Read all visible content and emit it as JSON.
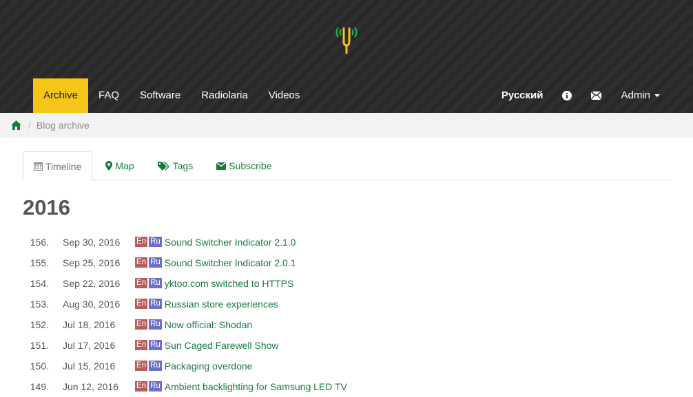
{
  "header": {
    "nav": [
      {
        "label": "Archive",
        "active": true
      },
      {
        "label": "FAQ"
      },
      {
        "label": "Software"
      },
      {
        "label": "Radiolaria"
      },
      {
        "label": "Videos"
      }
    ],
    "language": "Русский",
    "info_icon": "info-icon",
    "mail_icon": "envelope-icon",
    "user_menu": "Admin"
  },
  "breadcrumb": {
    "home_icon": "home-icon",
    "current": "Blog archive"
  },
  "tabs": [
    {
      "label": "Timeline",
      "icon": "calendar-icon",
      "active": true
    },
    {
      "label": "Map",
      "icon": "map-marker-icon"
    },
    {
      "label": "Tags",
      "icon": "tags-icon"
    },
    {
      "label": "Subscribe",
      "icon": "envelope-icon"
    }
  ],
  "year": "2016",
  "posts": [
    {
      "num": "156.",
      "date": "Sep 30, 2016",
      "flags": [
        "En",
        "Ru"
      ],
      "title": "Sound Switcher Indicator 2.1.0"
    },
    {
      "num": "155.",
      "date": "Sep 25, 2016",
      "flags": [
        "En",
        "Ru"
      ],
      "title": "Sound Switcher Indicator 2.0.1"
    },
    {
      "num": "154.",
      "date": "Sep 22, 2016",
      "flags": [
        "En",
        "Ru"
      ],
      "title": "yktoo.com switched to HTTPS"
    },
    {
      "num": "153.",
      "date": "Aug 30, 2016",
      "flags": [
        "En",
        "Ru"
      ],
      "title": "Russian store experiences"
    },
    {
      "num": "152.",
      "date": "Jul 18, 2016",
      "flags": [
        "En",
        "Ru"
      ],
      "title": "Now official: Shodan"
    },
    {
      "num": "151.",
      "date": "Jul 17, 2016",
      "flags": [
        "En",
        "Ru"
      ],
      "title": "Sun Caged Farewell Show"
    },
    {
      "num": "150.",
      "date": "Jul 15, 2016",
      "flags": [
        "En",
        "Ru"
      ],
      "title": "Packaging overdone"
    },
    {
      "num": "149.",
      "date": "Jun 12, 2016",
      "flags": [
        "En",
        "Ru"
      ],
      "title": "Ambient backlighting for Samsung LED TV"
    }
  ],
  "colors": {
    "accent": "#f5c518",
    "link": "#1a7a3e",
    "flag_en": "#b85c5c",
    "flag_ru": "#6f6fc9"
  }
}
